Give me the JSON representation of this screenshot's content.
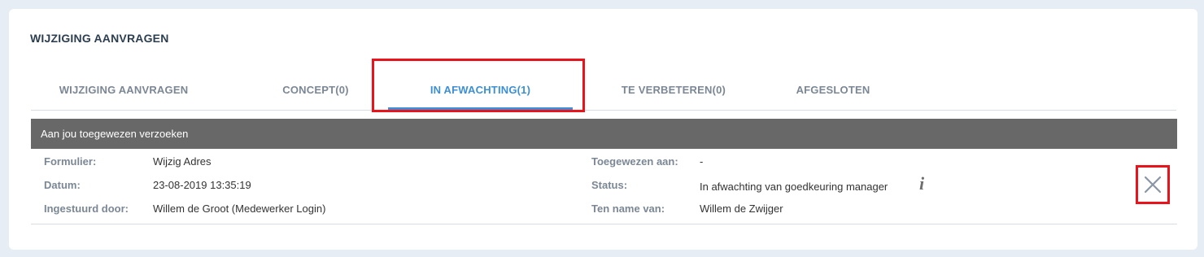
{
  "card": {
    "title": "WIJZIGING AANVRAGEN"
  },
  "tabs": [
    {
      "label": "WIJZIGING AANVRAGEN"
    },
    {
      "label": "CONCEPT(0)"
    },
    {
      "label": "IN AFWACHTING(1)"
    },
    {
      "label": "TE VERBETEREN(0)"
    },
    {
      "label": "AFGESLOTEN"
    }
  ],
  "active_tab": "IN AFWACHTING(1)",
  "section": {
    "header": "Aan jou toegewezen verzoeken"
  },
  "request": {
    "formulier_label": "Formulier:",
    "formulier_value": "Wijzig Adres",
    "datum_label": "Datum:",
    "datum_value": "23-08-2019 13:35:19",
    "ingestuurd_label": "Ingestuurd door:",
    "ingestuurd_value": "Willem de Groot (Medewerker Login)",
    "toegewezen_label": "Toegewezen aan:",
    "toegewezen_value": "-",
    "status_label": "Status:",
    "status_value": "In afwachting van goedkeuring manager",
    "ten_name_label": "Ten name van:",
    "ten_name_value": "Willem de Zwijger"
  },
  "icons": {
    "info": "info-icon",
    "close": "close-icon"
  },
  "colors": {
    "accent": "#3c8fd6",
    "highlight": "#e8131b",
    "header_bg": "#686868"
  }
}
